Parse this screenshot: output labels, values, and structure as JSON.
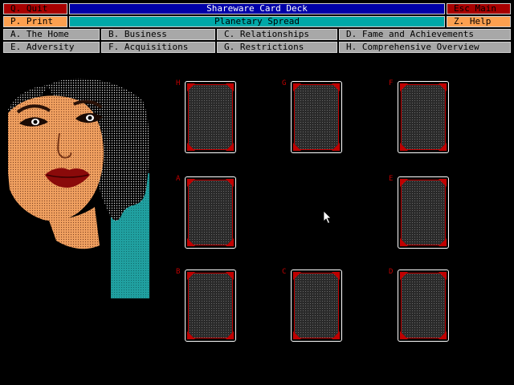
{
  "top": {
    "quit": "Q. Quit",
    "title": "Shareware Card Deck",
    "esc_main": "Esc Main",
    "print": "P. Print",
    "spread": "Planetary Spread",
    "help": "Z. Help"
  },
  "menu": {
    "a": "A. The Home",
    "b": "B. Business",
    "c": "C. Relationships",
    "d": "D. Fame and Achievements",
    "e": "E. Adversity",
    "f": "F. Acquisitions",
    "g": "G. Restrictions",
    "h": "H. Comprehensive Overview"
  },
  "slots": {
    "h": "H",
    "g": "G",
    "f": "F",
    "a": "A",
    "e": "E",
    "b": "B",
    "c": "C",
    "d": "D"
  },
  "colors": {
    "quit_bg": "#a80000",
    "title_bg": "#0000a8",
    "spread_bg": "#00a8a8",
    "orange_bg": "#fca050",
    "menu_bg": "#a8a8a8",
    "card_accent": "#c00000"
  },
  "icons": {
    "cursor": "mouse-pointer-icon",
    "portrait": "woman-portrait-image"
  }
}
